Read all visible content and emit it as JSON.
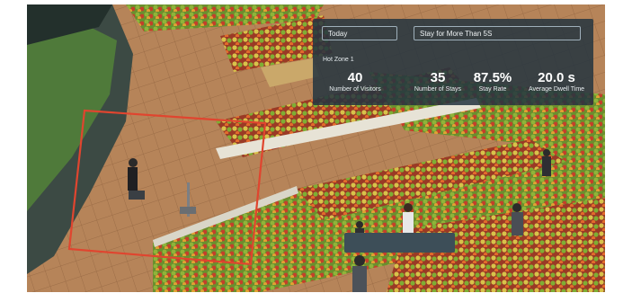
{
  "controls": {
    "period_value": "Today",
    "rule_value": "Stay for More Than 5S"
  },
  "zone": {
    "name": "Hot Zone 1"
  },
  "stats": [
    {
      "value": "40",
      "label": "Number of Visitors"
    },
    {
      "value": "35",
      "label": "Number of Stays"
    },
    {
      "value": "87.5%",
      "label": "Stay Rate"
    },
    {
      "value": "20.0 s",
      "label": "Average Dwell Time"
    }
  ],
  "colors": {
    "zone_outline": "#e0452f",
    "panel_bg": "#243440"
  }
}
